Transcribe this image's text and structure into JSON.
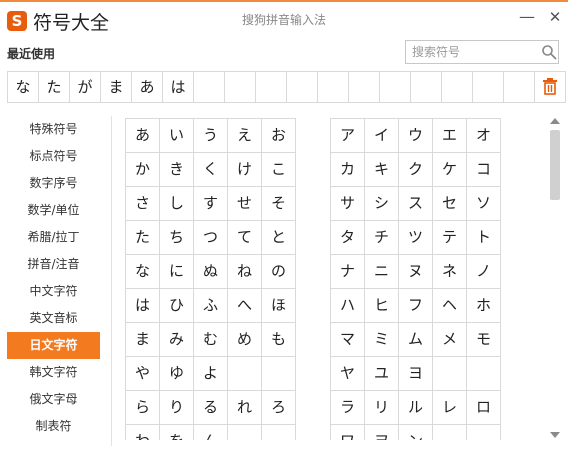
{
  "window": {
    "logo_letter": "S",
    "title": "符号大全",
    "subtitle": "搜狗拼音输入法",
    "minimize_label": "—",
    "close_label": "✕"
  },
  "recent": {
    "label": "最近使用",
    "symbols": [
      "な",
      "た",
      "が",
      "ま",
      "あ",
      "は",
      "",
      "",
      "",
      "",
      "",
      "",
      "",
      "",
      "",
      "",
      "",
      ""
    ]
  },
  "search": {
    "placeholder": "搜索符号",
    "value": ""
  },
  "icons": {
    "search": "search-icon",
    "trash": "trash-icon"
  },
  "colors": {
    "accent": "#f47a20",
    "logo": "#e85c0d",
    "trash": "#e85c0d"
  },
  "sidebar": {
    "items": [
      {
        "label": "特殊符号",
        "active": false
      },
      {
        "label": "标点符号",
        "active": false
      },
      {
        "label": "数字序号",
        "active": false
      },
      {
        "label": "数学/单位",
        "active": false
      },
      {
        "label": "希腊/拉丁",
        "active": false
      },
      {
        "label": "拼音/注音",
        "active": false
      },
      {
        "label": "中文字符",
        "active": false
      },
      {
        "label": "英文音标",
        "active": false
      },
      {
        "label": "日文字符",
        "active": true
      },
      {
        "label": "韩文字符",
        "active": false
      },
      {
        "label": "俄文字母",
        "active": false
      },
      {
        "label": "制表符",
        "active": false
      }
    ]
  },
  "hiragana": [
    [
      "あ",
      "い",
      "う",
      "え",
      "お"
    ],
    [
      "か",
      "き",
      "く",
      "け",
      "こ"
    ],
    [
      "さ",
      "し",
      "す",
      "せ",
      "そ"
    ],
    [
      "た",
      "ち",
      "つ",
      "て",
      "と"
    ],
    [
      "な",
      "に",
      "ぬ",
      "ね",
      "の"
    ],
    [
      "は",
      "ひ",
      "ふ",
      "へ",
      "ほ"
    ],
    [
      "ま",
      "み",
      "む",
      "め",
      "も"
    ],
    [
      "や",
      "ゆ",
      "よ",
      "",
      ""
    ],
    [
      "ら",
      "り",
      "る",
      "れ",
      "ろ"
    ],
    [
      "わ",
      "を",
      "ん",
      "",
      ""
    ]
  ],
  "katakana": [
    [
      "ア",
      "イ",
      "ウ",
      "エ",
      "オ"
    ],
    [
      "カ",
      "キ",
      "ク",
      "ケ",
      "コ"
    ],
    [
      "サ",
      "シ",
      "ス",
      "セ",
      "ソ"
    ],
    [
      "タ",
      "チ",
      "ツ",
      "テ",
      "ト"
    ],
    [
      "ナ",
      "ニ",
      "ヌ",
      "ネ",
      "ノ"
    ],
    [
      "ハ",
      "ヒ",
      "フ",
      "ヘ",
      "ホ"
    ],
    [
      "マ",
      "ミ",
      "ム",
      "メ",
      "モ"
    ],
    [
      "ヤ",
      "ユ",
      "ヨ",
      "",
      ""
    ],
    [
      "ラ",
      "リ",
      "ル",
      "レ",
      "ロ"
    ],
    [
      "ワ",
      "ヲ",
      "ン",
      "",
      ""
    ]
  ]
}
